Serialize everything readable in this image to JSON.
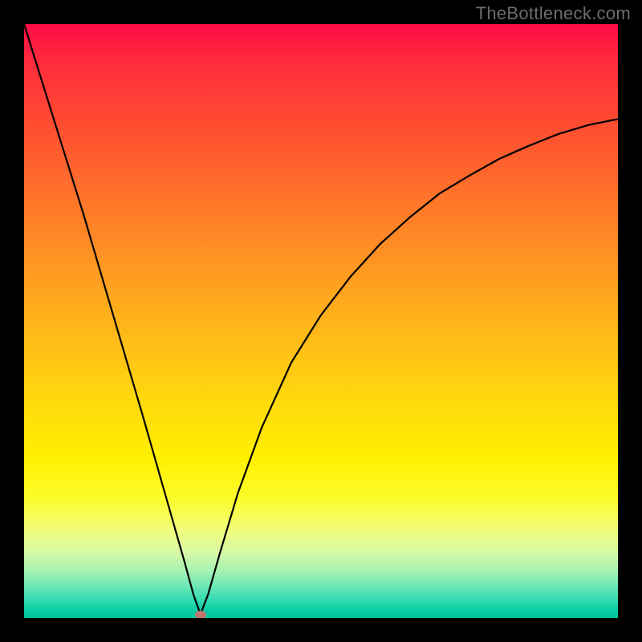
{
  "watermark": "TheBottleneck.com",
  "marker": {
    "x_frac": 0.297,
    "y_frac": 0.994
  },
  "chart_data": {
    "type": "line",
    "title": "",
    "xlabel": "",
    "ylabel": "",
    "xlim": [
      0,
      1
    ],
    "ylim": [
      0,
      1
    ],
    "background": "vertical-gradient red→yellow→green",
    "note": "No axis ticks or labels visible. Values are normalized fractions of plot area; y is plotted as height from bottom (1 = top, 0 = bottom). Curve shape: left branch nearly straight steep descent from top-left to a minimum near x≈0.30, then right branch rises with decreasing slope toward upper-right (ending ≈0.84 height at x=1). A small markered point sits at the minimum.",
    "series": [
      {
        "name": "bottleneck-curve",
        "x": [
          0.0,
          0.05,
          0.1,
          0.15,
          0.2,
          0.24,
          0.27,
          0.285,
          0.297,
          0.31,
          0.33,
          0.36,
          0.4,
          0.45,
          0.5,
          0.55,
          0.6,
          0.65,
          0.7,
          0.75,
          0.8,
          0.85,
          0.9,
          0.95,
          1.0
        ],
        "y": [
          1.0,
          0.84,
          0.68,
          0.51,
          0.34,
          0.2,
          0.095,
          0.04,
          0.006,
          0.04,
          0.11,
          0.21,
          0.32,
          0.43,
          0.51,
          0.575,
          0.63,
          0.675,
          0.715,
          0.745,
          0.773,
          0.795,
          0.815,
          0.83,
          0.84
        ]
      }
    ],
    "annotations": [
      {
        "type": "point",
        "name": "minimum-marker",
        "x": 0.297,
        "y": 0.006,
        "color": "#c07770"
      }
    ]
  }
}
